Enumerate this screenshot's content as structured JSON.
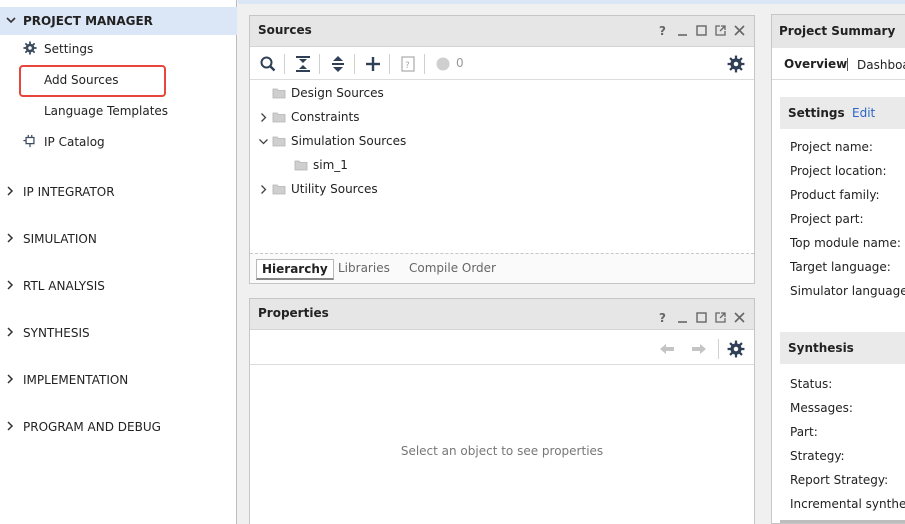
{
  "flow_nav": {
    "project_manager": {
      "label": "PROJECT MANAGER",
      "items": [
        {
          "label": "Settings",
          "icon": "gear-icon"
        },
        {
          "label": "Add Sources",
          "icon": ""
        },
        {
          "label": "Language Templates",
          "icon": ""
        },
        {
          "label": "IP Catalog",
          "icon": "ip-plug-icon"
        }
      ]
    },
    "sections": [
      {
        "label": "IP INTEGRATOR"
      },
      {
        "label": "SIMULATION"
      },
      {
        "label": "RTL ANALYSIS"
      },
      {
        "label": "SYNTHESIS"
      },
      {
        "label": "IMPLEMENTATION"
      },
      {
        "label": "PROGRAM AND DEBUG"
      }
    ]
  },
  "sources": {
    "title": "Sources",
    "status_count": "0",
    "tree": [
      {
        "label": "Design Sources",
        "expand": "none",
        "level": 0
      },
      {
        "label": "Constraints",
        "expand": "collapsed",
        "level": 0
      },
      {
        "label": "Simulation Sources",
        "expand": "expanded",
        "level": 0
      },
      {
        "label": "sim_1",
        "expand": "none",
        "level": 1
      },
      {
        "label": "Utility Sources",
        "expand": "collapsed",
        "level": 0
      }
    ],
    "tabs": [
      {
        "label": "Hierarchy",
        "active": true
      },
      {
        "label": "Libraries",
        "active": false
      },
      {
        "label": "Compile Order",
        "active": false
      }
    ]
  },
  "properties": {
    "title": "Properties",
    "empty_message": "Select an object to see properties"
  },
  "summary": {
    "title": "Project Summary",
    "tab_overview": "Overview",
    "tab_dashboard": "Dashboa",
    "settings_header": "Settings",
    "settings_edit": "Edit",
    "settings_labels": [
      "Project name:",
      "Project location:",
      "Product family:",
      "Project part:",
      "Top module name:",
      "Target language:",
      "Simulator language:"
    ],
    "synthesis_header": "Synthesis",
    "synthesis_labels": [
      "Status:",
      "Messages:",
      "Part:",
      "Strategy:",
      "Report Strategy:",
      "Incremental synthesis"
    ]
  },
  "colors": {
    "accent": "#2a66c9",
    "highlight": "#e8453c",
    "nav_selected_bg": "#dbe6f6"
  }
}
